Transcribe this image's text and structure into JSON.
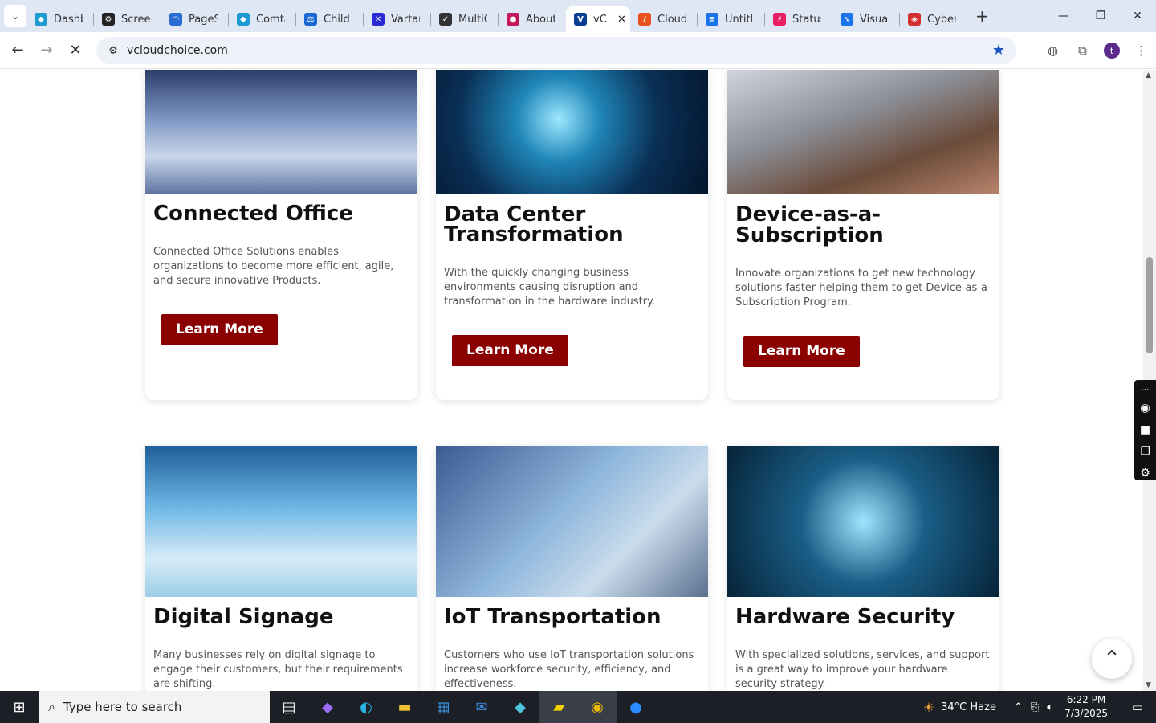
{
  "browser": {
    "tabs": [
      {
        "title": "Dashbo",
        "color": "#1d9bd1"
      },
      {
        "title": "Screen",
        "color": "#222"
      },
      {
        "title": "PageSp",
        "color": "#2b6cd3"
      },
      {
        "title": "Comtal",
        "color": "#1d9bd1"
      },
      {
        "title": "Child F",
        "color": "#1967d2"
      },
      {
        "title": "Vartan",
        "color": "#2b2bd3"
      },
      {
        "title": "MultiC",
        "color": "#333"
      },
      {
        "title": "About",
        "color": "#c2185b"
      },
      {
        "title": "vC",
        "color": "#0b3d91",
        "active": true
      },
      {
        "title": "Cloud",
        "color": "#e8501f"
      },
      {
        "title": "Untitle",
        "color": "#1a73e8"
      },
      {
        "title": "StatusC",
        "color": "#e91e63"
      },
      {
        "title": "Visualp",
        "color": "#1a73e8"
      },
      {
        "title": "Cybers",
        "color": "#d32f2f"
      }
    ],
    "url": "vcloudchoice.com",
    "profile_initial": "t"
  },
  "cards_row1": [
    {
      "title": "Connected Office",
      "description": "Connected Office Solutions enables organizations to become more efficient, agile, and secure innovative Products.",
      "button": "Learn More"
    },
    {
      "title": "Data Center Transformation",
      "description": "With the quickly changing business environments causing disruption and transformation in the hardware industry.",
      "button": "Learn More"
    },
    {
      "title": "Device-as-a-Subscription",
      "description": "Innovate organizations to get new technology solutions faster helping them to get Device-as-a-Subscription Program.",
      "button": "Learn More"
    }
  ],
  "cards_row2": [
    {
      "title": "Digital Signage",
      "description": "Many businesses rely on digital signage to engage their customers, but their requirements are shifting."
    },
    {
      "title": "IoT Transportation",
      "description": "Customers who use IoT transportation solutions increase workforce security, efficiency, and effectiveness."
    },
    {
      "title": "Hardware Security",
      "description": "With specialized solutions, services, and support is a great way to improve your hardware security strategy."
    }
  ],
  "taskbar": {
    "search_placeholder": "Type here to search",
    "weather": "34°C  Haze",
    "time": "6:22 PM",
    "date": "7/3/2025"
  }
}
